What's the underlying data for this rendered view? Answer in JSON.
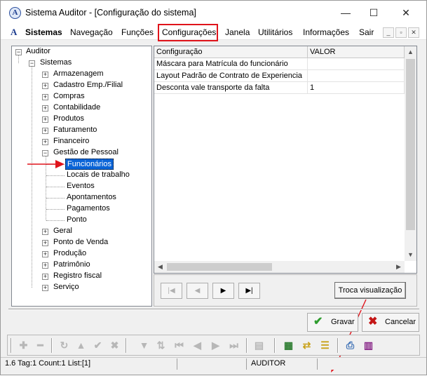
{
  "window": {
    "title": "Sistema Auditor - [Configuração do sistema]",
    "controls": {
      "minimize": "—",
      "maximize": "☐",
      "close": "✕"
    }
  },
  "menubar": {
    "items": [
      {
        "label": "Sistemas",
        "bold": true
      },
      {
        "label": "Navegação"
      },
      {
        "label": "Funções"
      },
      {
        "label": "Configurações",
        "highlighted": true
      },
      {
        "label": "Janela"
      },
      {
        "label": "Utilitários"
      },
      {
        "label": "Informações"
      },
      {
        "label": "Sair"
      }
    ],
    "mdi_controls": [
      "_",
      "▫",
      "✕"
    ]
  },
  "tree": {
    "root": "Auditor",
    "sistemas": "Sistemas",
    "modules": [
      "Armazenagem",
      "Cadastro Emp./Filial",
      "Compras",
      "Contabilidade",
      "Produtos",
      "Faturamento",
      "Financeiro"
    ],
    "gestao": "Gestão de Pessoal",
    "gestao_children": [
      "Funcionários",
      "Locais de trabalho",
      "Eventos",
      "Apontamentos",
      "Pagamentos",
      "Ponto"
    ],
    "selected": "Funcionários",
    "modules_after": [
      "Geral",
      "Ponto de Venda",
      "Produção",
      "Patrimônio",
      "Registro fiscal",
      "Serviço"
    ]
  },
  "grid": {
    "columns": [
      "Configuração",
      "VALOR"
    ],
    "rows": [
      [
        "Máscara para Matrícula do funcionário",
        ""
      ],
      [
        "Layout Padrão de Contrato de Experiencia",
        ""
      ],
      [
        "Desconta vale transporte da falta",
        "1"
      ]
    ]
  },
  "navigator": {
    "first": "|◀",
    "prior": "◀",
    "next": "▶",
    "last": "▶|",
    "toggle_view_label": "Troca visualização"
  },
  "actions": {
    "save_label": "Gravar",
    "cancel_label": "Cancelar"
  },
  "statusbar": {
    "info": "1.6 Tag:1 Count:1 List:[1]",
    "blank1": "",
    "user": "AUDITOR",
    "blank2": ""
  },
  "colors": {
    "highlight_box": "#e0141b",
    "annotation_arrow": "#e0141b",
    "selection": "#0a64d7",
    "save_check": "#2e9d2e",
    "cancel_x": "#c41616"
  }
}
